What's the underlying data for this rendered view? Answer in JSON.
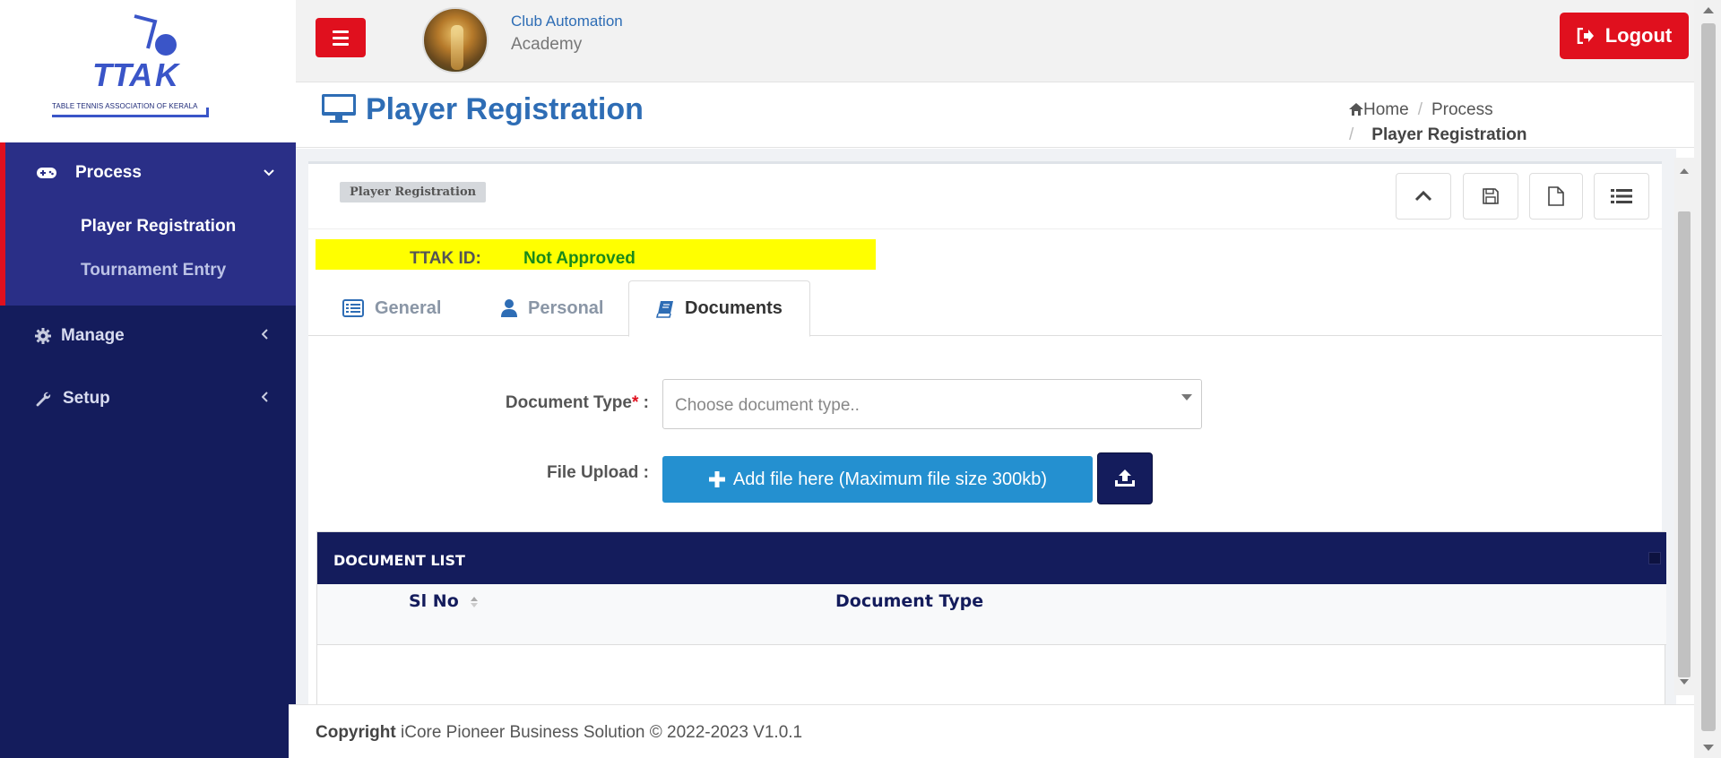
{
  "logo": {
    "alt": "TTAK",
    "caption": "TABLE TENNIS ASSOCIATION OF KERALA"
  },
  "sidebar": {
    "process": {
      "label": "Process",
      "icon": "gamepad-icon",
      "items": [
        {
          "label": "Player Registration",
          "active": true
        },
        {
          "label": "Tournament Entry",
          "active": false
        }
      ]
    },
    "manage": {
      "label": "Manage",
      "icon": "gear-icon"
    },
    "setup": {
      "label": "Setup",
      "icon": "wrench-icon"
    }
  },
  "header": {
    "org_name": "Club Automation",
    "org_sub": "Academy",
    "logout_label": "Logout"
  },
  "page": {
    "title": "Player Registration",
    "breadcrumb": {
      "home": "Home",
      "process": "Process",
      "current": "Player Registration"
    }
  },
  "panel": {
    "badge": "Player Registration",
    "ttak_label": "TTAK ID:",
    "ttak_value": "Not Approved",
    "tabs": [
      {
        "label": "General",
        "icon": "list-alt-icon"
      },
      {
        "label": "Personal",
        "icon": "user-icon"
      },
      {
        "label": "Documents",
        "icon": "book-icon",
        "active": true
      }
    ]
  },
  "form": {
    "document_type_label": "Document Type",
    "document_type_suffix": " :",
    "document_type_placeholder": "Choose document type..",
    "file_upload_label": "File Upload :",
    "add_file_label": "Add file here (Maximum file size 300kb)"
  },
  "document_list": {
    "title": "DOCUMENT LIST",
    "columns": [
      "Sl No",
      "Document Type"
    ]
  },
  "footer": {
    "copyright": "Copyright",
    "text": "iCore Pioneer Business Solution © 2022-2023 V1.0.1"
  },
  "colors": {
    "sidebar": "#141c5c",
    "accent_red": "#e0101e",
    "title_blue": "#2e6db5",
    "upload_blue": "#2490d0",
    "highlight": "#ffff00"
  }
}
